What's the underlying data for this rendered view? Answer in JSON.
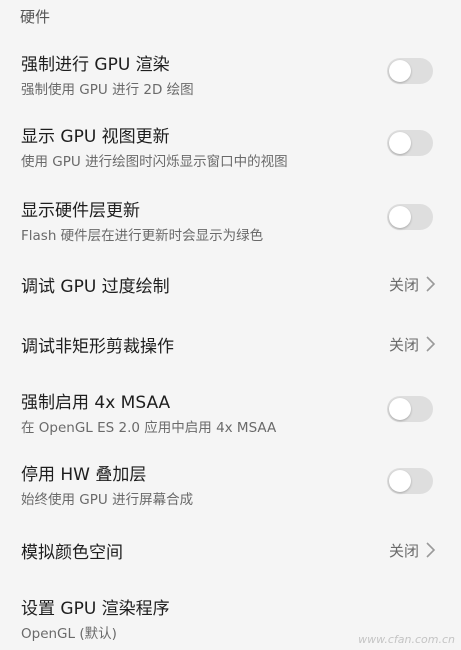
{
  "section": {
    "header": "硬件"
  },
  "settings": [
    {
      "title": "强制进行 GPU 渲染",
      "subtitle": "强制使用 GPU 进行 2D 绘图",
      "control": "toggle",
      "enabled": false
    },
    {
      "title": "显示 GPU 视图更新",
      "subtitle": "使用 GPU 进行绘图时闪烁显示窗口中的视图",
      "control": "toggle",
      "enabled": false
    },
    {
      "title": "显示硬件层更新",
      "subtitle": "Flash 硬件层在进行更新时会显示为绿色",
      "control": "toggle",
      "enabled": false
    },
    {
      "title": "调试 GPU 过度绘制",
      "control": "nav",
      "value": "关闭"
    },
    {
      "title": "调试非矩形剪裁操作",
      "control": "nav",
      "value": "关闭"
    },
    {
      "title": "强制启用 4x MSAA",
      "subtitle": "在 OpenGL ES 2.0 应用中启用 4x MSAA",
      "control": "toggle",
      "enabled": false
    },
    {
      "title": "停用 HW 叠加层",
      "subtitle": "始终使用 GPU 进行屏幕合成",
      "control": "toggle",
      "enabled": false
    },
    {
      "title": "模拟颜色空间",
      "control": "nav",
      "value": "关闭"
    },
    {
      "title": "设置 GPU 渲染程序",
      "subtitle": "OpenGL (默认)",
      "control": "nav-plain"
    }
  ],
  "watermark": "www.cfan.com.cn",
  "colors": {
    "background": "#f5f5f5",
    "toggle_off_track": "#dedede",
    "toggle_knob": "#ffffff",
    "secondary_text": "#6a6a6a"
  },
  "icons": {
    "nav": "chevron-right-icon"
  }
}
